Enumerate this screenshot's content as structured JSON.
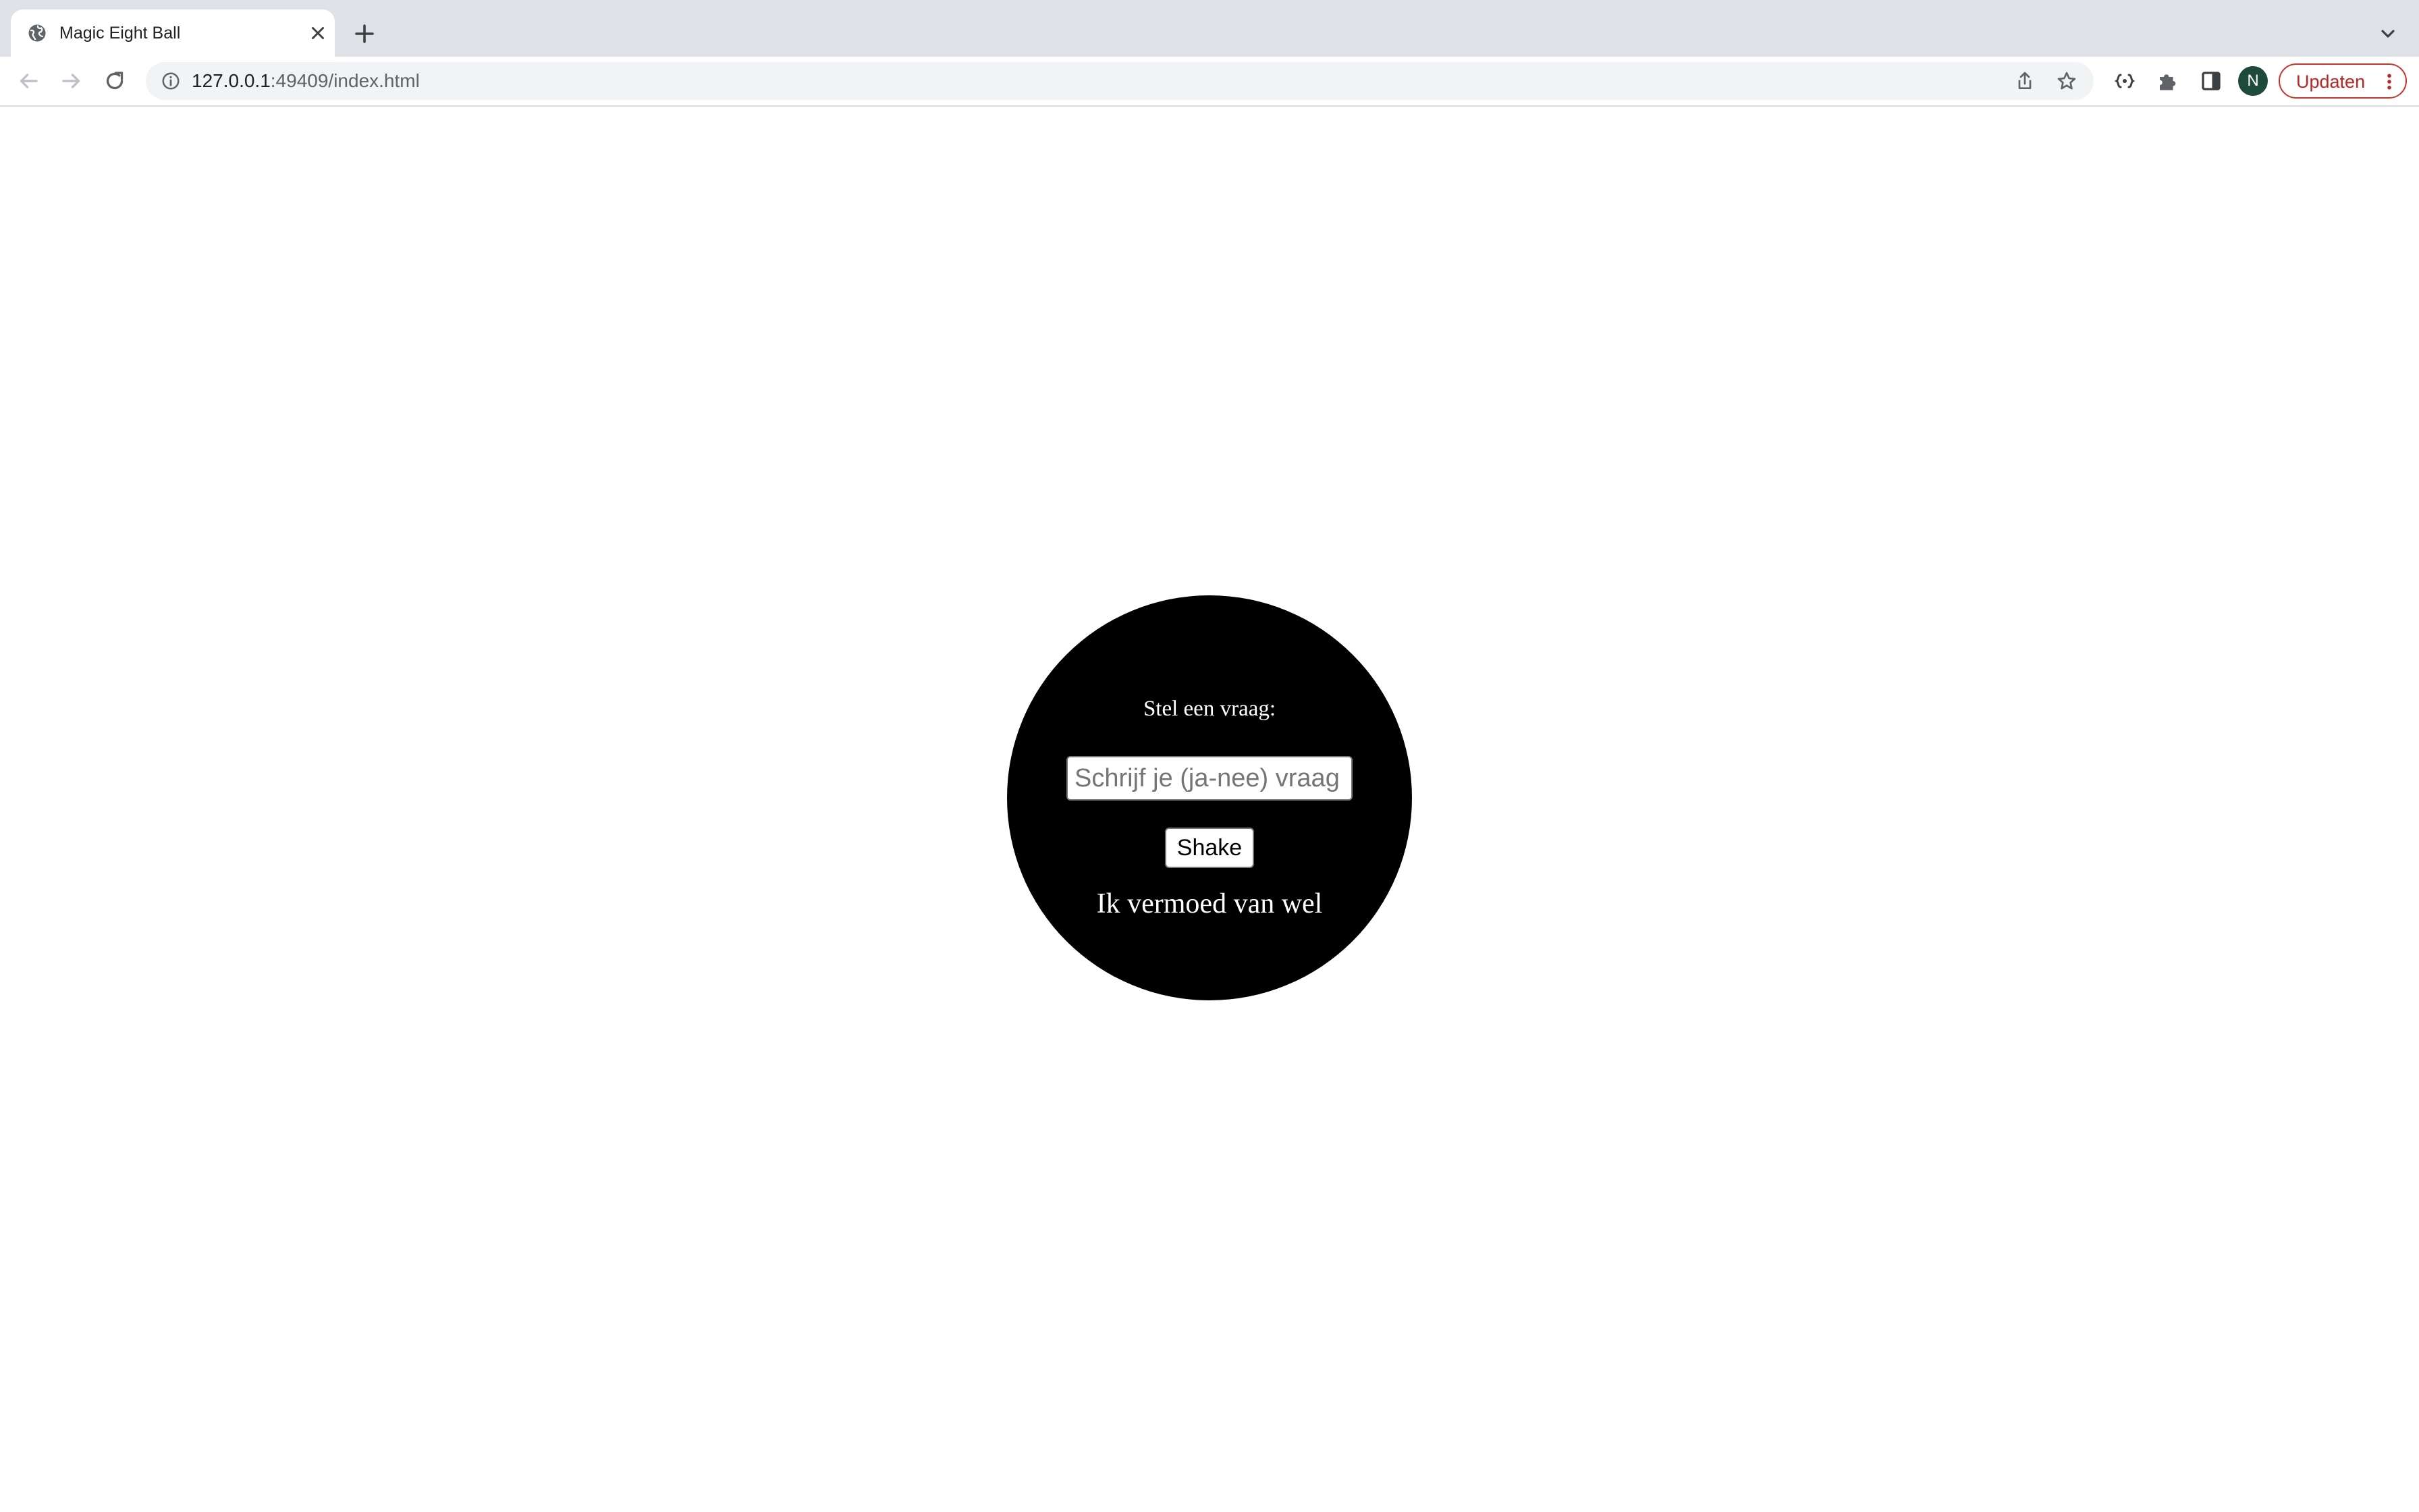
{
  "browser": {
    "tab": {
      "title": "Magic Eight Ball",
      "favicon_icon": "globe-icon",
      "close_icon": "close-icon"
    },
    "new_tab_icon": "plus-icon",
    "tab_search_icon": "chevron-down-icon",
    "nav": {
      "back_icon": "arrow-left-icon",
      "forward_icon": "arrow-right-icon",
      "reload_icon": "reload-icon"
    },
    "address_bar": {
      "info_icon": "info-icon",
      "url_host": "127.0.0.1",
      "url_rest": ":49409/index.html",
      "share_icon": "share-icon",
      "bookmark_icon": "star-icon"
    },
    "extensions_icons": [
      "devtools-extension-icon",
      "puzzle-icon",
      "side-panel-icon"
    ],
    "profile_initial": "N",
    "update_label": "Updaten",
    "menu_icon": "more-vertical-icon"
  },
  "ball": {
    "prompt": "Stel een vraag:",
    "input_placeholder": "Schrijf je (ja-nee) vraag",
    "input_value": "",
    "shake_label": "Shake",
    "answer": "Ik vermoed van wel"
  },
  "colors": {
    "ball": "#000000",
    "ball_text": "#ffffff",
    "update_accent": "#d93025",
    "avatar": "#1e4a3c"
  }
}
